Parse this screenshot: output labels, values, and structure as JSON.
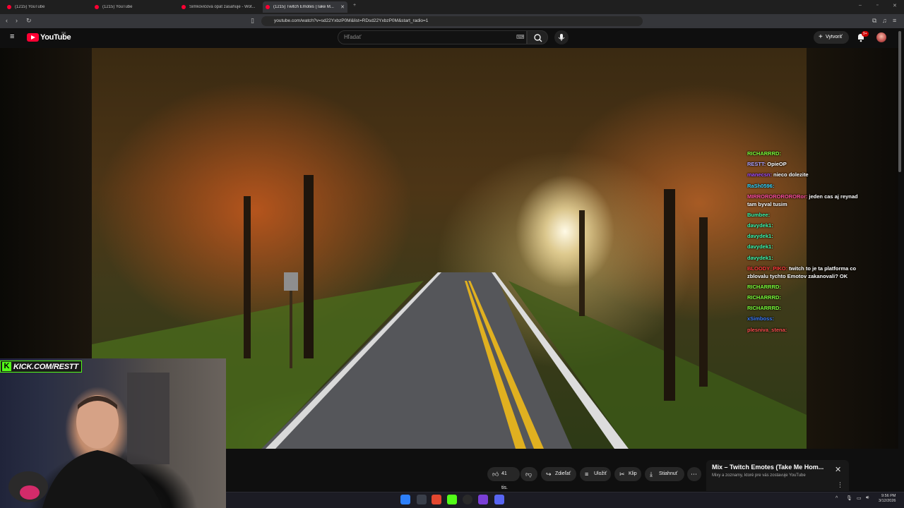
{
  "browser": {
    "tabs": [
      {
        "label": "(1215) YouTube"
      },
      {
        "label": "(1215) YouTube"
      },
      {
        "label": "Šimkovičová opät zasahuje - Wot..."
      },
      {
        "label": "(1215) Twitch Emotes (Take M..."
      }
    ],
    "url": "youtube.com/watch?v=sd22YxbzP0M&list=RDsd22YxbzP0M&start_radio=1"
  },
  "youtube": {
    "logo_text": "YouTube",
    "country": "SK",
    "search_placeholder": "Hľadať",
    "create_label": "Vytvoriť",
    "notification_count": "9+"
  },
  "chat": [
    {
      "user": "RICHARRRD:",
      "color": "#7bff3a",
      "msg": ""
    },
    {
      "user": "RESTT:",
      "color": "#b0a4ff",
      "msg": "OpieOP"
    },
    {
      "user": "manecsn:",
      "color": "#a14cff",
      "msg": "nieco dolezite"
    },
    {
      "user": "RaSh0596:",
      "color": "#35d7ff",
      "msg": ""
    },
    {
      "user": "MIRRORORORORORor:",
      "color": "#ff4fa0",
      "msg": "jeden cas aj reynad tam byval tusim"
    },
    {
      "user": "Bumbee:",
      "color": "#3dfcb0",
      "msg": ""
    },
    {
      "user": "davydek1:",
      "color": "#3dfcb0",
      "msg": ""
    },
    {
      "user": "davydek1:",
      "color": "#3dfcb0",
      "msg": ""
    },
    {
      "user": "davydek1:",
      "color": "#3dfcb0",
      "msg": ""
    },
    {
      "user": "davydek1:",
      "color": "#3dfcb0",
      "msg": ""
    },
    {
      "user": "BLOODY_PIKO:",
      "color": "#ff3a3a",
      "msg": "twitch to je ta platforma co zblovalu tychto Emotov zakanovali? OK"
    },
    {
      "user": "RICHARRRD:",
      "color": "#7bff3a",
      "msg": ""
    },
    {
      "user": "RICHARRRD:",
      "color": "#7bff3a",
      "msg": ""
    },
    {
      "user": "RICHARRRD:",
      "color": "#7bff3a",
      "msg": ""
    },
    {
      "user": "xSimboss:",
      "color": "#3a7bff",
      "msg": ""
    },
    {
      "user": "plesniva_stena:",
      "color": "#ff4f4f",
      "msg": ""
    }
  ],
  "webcam": {
    "tag_letter": "K",
    "tag_text": "KICK.COM/RESTT"
  },
  "actions": {
    "like_count": "41 tis.",
    "share_label": "Zdieľať",
    "save_label": "Uložiť",
    "clip_label": "Klip",
    "download_label": "Stiahnuť"
  },
  "mix": {
    "title": "Mix – Twitch Emotes (Take Me Hom...",
    "subtitle": "Mixy a zoznamy, ktoré pre vás zostavuje YouTube"
  },
  "taskbar": {
    "time": "9:56 PM",
    "date": "3/12/2026"
  },
  "colors": {
    "youtube_red": "#ff0033",
    "kick_green": "#53fc18"
  }
}
